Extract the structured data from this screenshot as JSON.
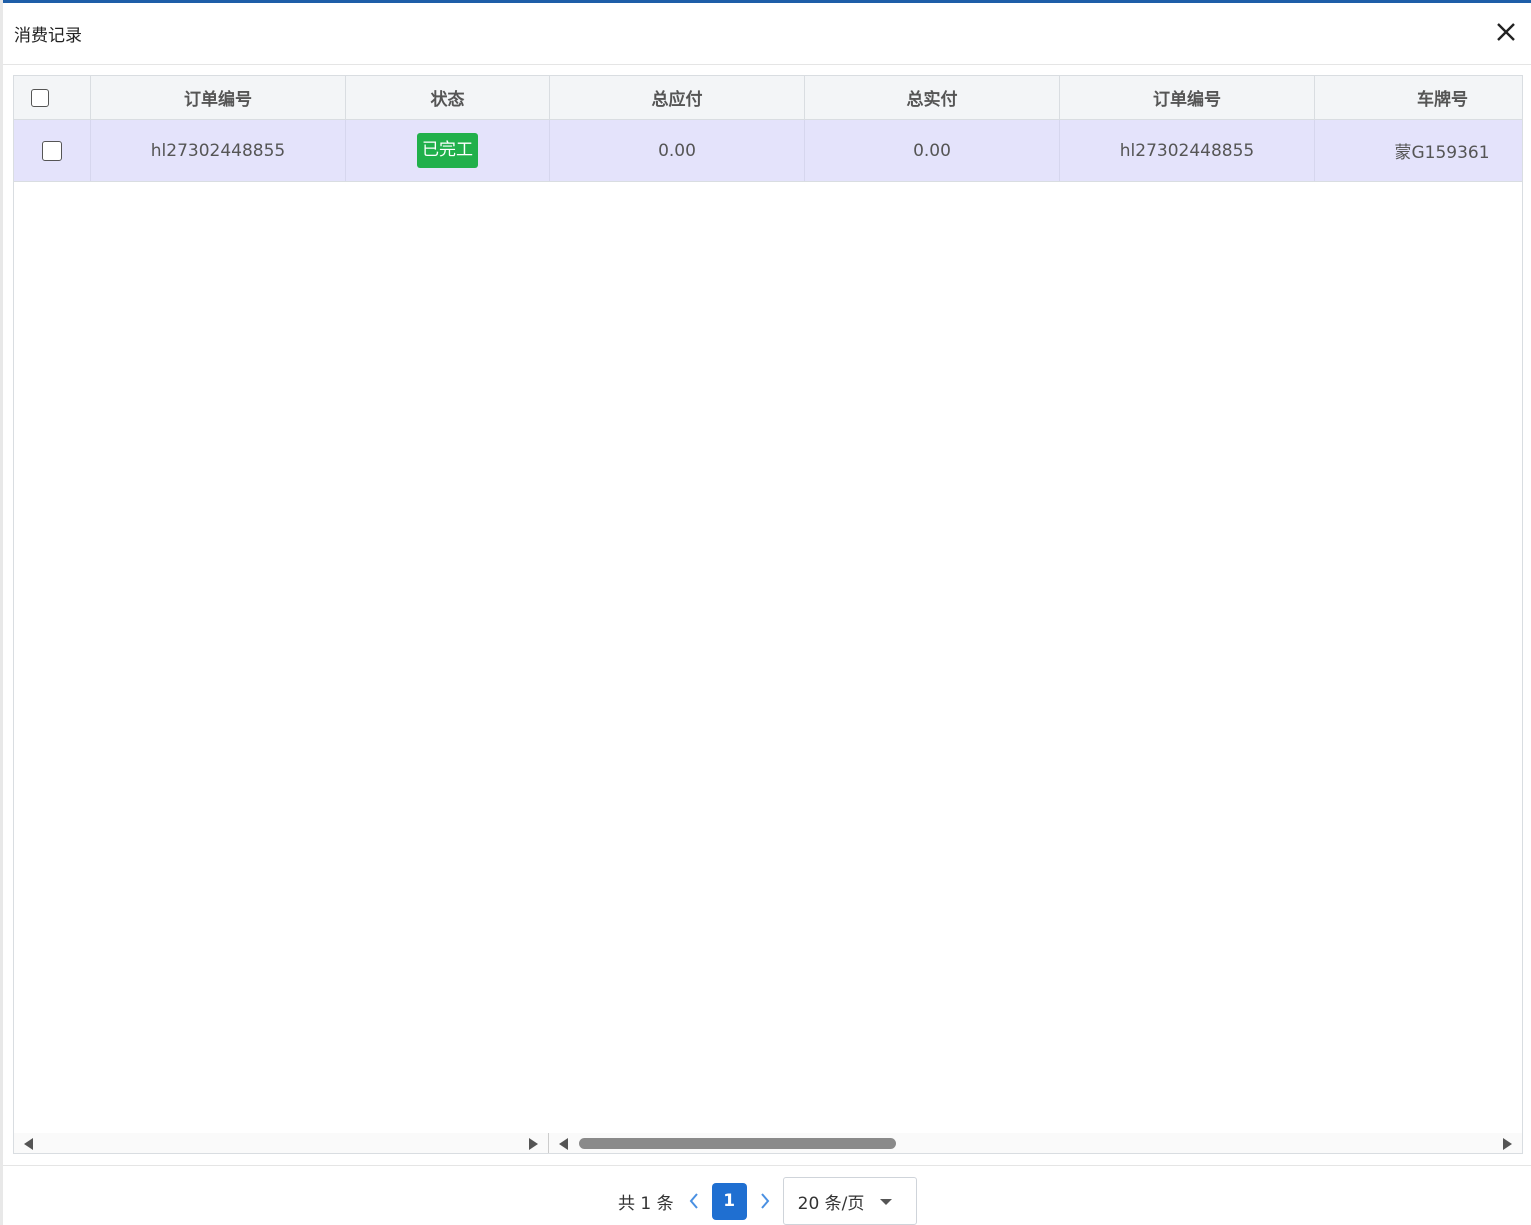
{
  "dialog": {
    "title": "消费记录",
    "close_icon": "close-icon"
  },
  "table": {
    "columns": [
      "订单编号",
      "状态",
      "总应付",
      "总实付",
      "订单编号",
      "车牌号"
    ],
    "rows": [
      {
        "order_no": "hl27302448855",
        "status": "已完工",
        "total_due": "0.00",
        "total_paid": "0.00",
        "order_no_2": "hl27302448855",
        "plate": "蒙G159361"
      }
    ],
    "status_color": "#21b04b",
    "selected_row_color": "#e4e3fb"
  },
  "pagination": {
    "total_text": "共 1 条",
    "current_page": "1",
    "page_size": "20 条/页",
    "accent": "#1f6fd1"
  }
}
